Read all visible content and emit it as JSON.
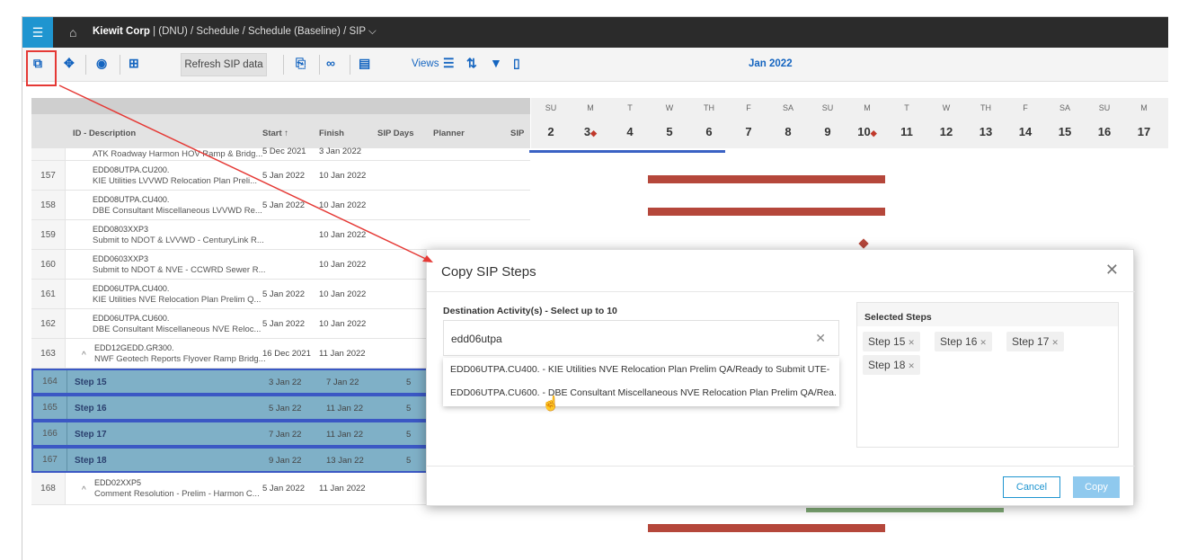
{
  "breadcrumb": {
    "org": "Kiewit Corp",
    "rest": " | (DNU) / Schedule / Schedule (Baseline) / SIP"
  },
  "toolbar": {
    "refresh_label": "Refresh SIP data",
    "views_label": "Views",
    "month": "Jan 2022"
  },
  "grid": {
    "headers": {
      "id_desc": "ID - Description",
      "start": "Start",
      "finish": "Finish",
      "sip_days": "SIP Days",
      "planner": "Planner",
      "sip": "SIP"
    }
  },
  "rows": [
    {
      "num": "",
      "id": "",
      "desc": "ATK Roadway Harmon HOV Ramp & Bridg...",
      "start": "5 Dec 2021",
      "finish": "3 Jan 2022"
    },
    {
      "num": "157",
      "id": "EDD08UTPA.CU200.",
      "desc": "KIE Utilities LVVWD Relocation Plan Preli...",
      "start": "5 Jan 2022",
      "finish": "10 Jan 2022"
    },
    {
      "num": "158",
      "id": "EDD08UTPA.CU400.",
      "desc": "DBE Consultant Miscellaneous LVVWD Re...",
      "start": "5 Jan 2022",
      "finish": "10 Jan 2022"
    },
    {
      "num": "159",
      "id": "EDD0803XXP3",
      "desc": "Submit to NDOT & LVVWD - CenturyLink R...",
      "start": "",
      "finish": "10 Jan 2022"
    },
    {
      "num": "160",
      "id": "EDD0603XXP3",
      "desc": "Submit to NDOT & NVE - CCWRD Sewer R...",
      "start": "",
      "finish": "10 Jan 2022"
    },
    {
      "num": "161",
      "id": "EDD06UTPA.CU400.",
      "desc": "KIE Utilities NVE Relocation Plan Prelim Q...",
      "start": "5 Jan 2022",
      "finish": "10 Jan 2022"
    },
    {
      "num": "162",
      "id": "EDD06UTPA.CU600.",
      "desc": "DBE Consultant Miscellaneous NVE Reloc...",
      "start": "5 Jan 2022",
      "finish": "10 Jan 2022"
    },
    {
      "num": "163",
      "id": "EDD12GEDD.GR300.",
      "desc": "NWF Geotech Reports Flyover Ramp Bridg...",
      "start": "16 Dec 2021",
      "finish": "11 Jan 2022"
    }
  ],
  "step_rows": [
    {
      "num": "164",
      "label": "Step 15",
      "start": "3 Jan 22",
      "finish": "7 Jan 22",
      "days": "5"
    },
    {
      "num": "165",
      "label": "Step 16",
      "start": "5 Jan 22",
      "finish": "11 Jan 22",
      "days": "5"
    },
    {
      "num": "166",
      "label": "Step 17",
      "start": "7 Jan 22",
      "finish": "11 Jan 22",
      "days": "5"
    },
    {
      "num": "167",
      "label": "Step 18",
      "start": "9 Jan 22",
      "finish": "13 Jan 22",
      "days": "5"
    }
  ],
  "last_row": {
    "num": "168",
    "id": "EDD02XXP5",
    "desc": "Comment Resolution - Prelim - Harmon C...",
    "start": "5 Jan 2022",
    "finish": "11 Jan 2022"
  },
  "calendar": {
    "dow": [
      "SU",
      "M",
      "T",
      "W",
      "TH",
      "F",
      "SA",
      "SU",
      "M",
      "T",
      "W",
      "TH",
      "F",
      "SA",
      "SU",
      "M"
    ],
    "days": [
      "2",
      "3",
      "4",
      "5",
      "6",
      "7",
      "8",
      "9",
      "10",
      "11",
      "12",
      "13",
      "14",
      "15",
      "16",
      "17"
    ]
  },
  "dialog": {
    "title": "Copy SIP Steps",
    "dest_label": "Destination Activity(s) - Select up to 10",
    "dest_value": "edd06utpa",
    "options": [
      "EDD06UTPA.CU400. - KIE Utilities NVE Relocation Plan Prelim QA/Ready to Submit UTE-",
      "EDD06UTPA.CU600. - DBE Consultant Miscellaneous NVE Relocation Plan Prelim QA/Rea..."
    ],
    "selected_title": "Selected Steps",
    "chips": [
      "Step 15",
      "Step 16",
      "Step 17",
      "Step 18"
    ],
    "cancel": "Cancel",
    "copy": "Copy"
  },
  "colors": {
    "accent": "#1f95d0",
    "bar": "#b5473b",
    "selected_row": "#7fb0c7",
    "highlight": "#e53935"
  }
}
